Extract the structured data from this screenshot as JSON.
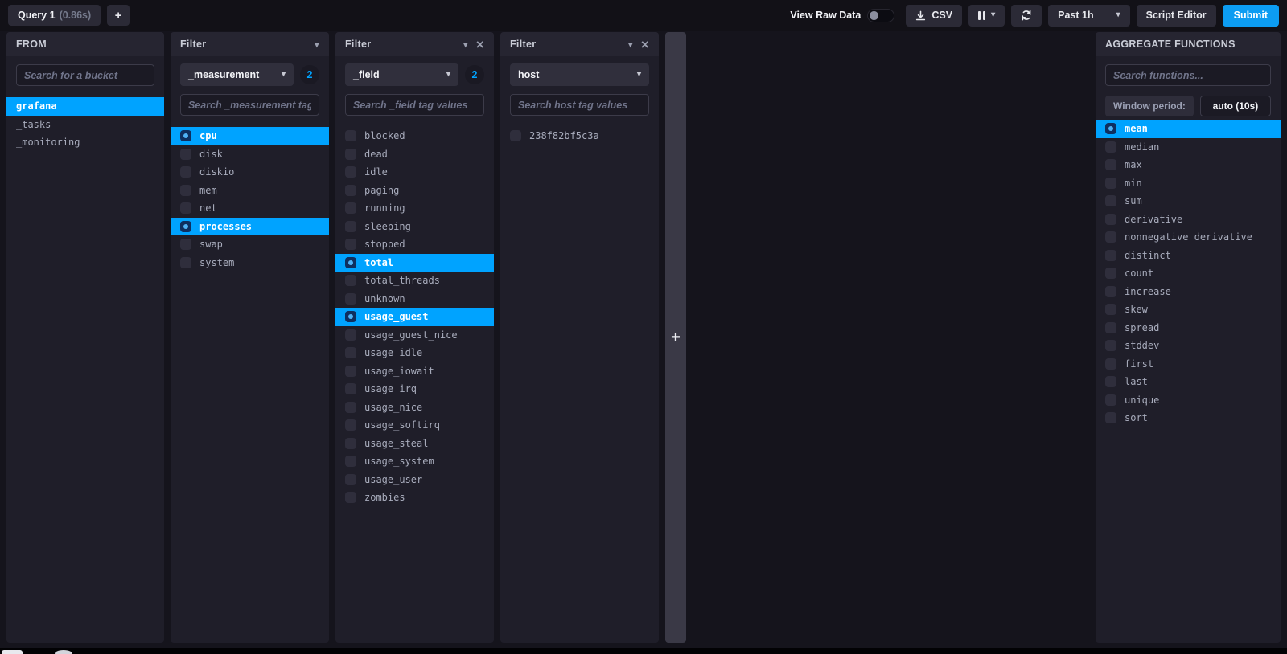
{
  "colors": {
    "accent": "#00a3ff",
    "submit": "#0c9cf2",
    "panel": "#1f1e29",
    "header": "#262531"
  },
  "topbar": {
    "query_tab": {
      "label": "Query 1",
      "duration": "(0.86s)"
    },
    "add_query_label": "+",
    "view_raw_data_label": "View Raw Data",
    "csv_label": "CSV",
    "time_range_label": "Past 1h",
    "script_editor_label": "Script Editor",
    "submit_label": "Submit"
  },
  "from_panel": {
    "title": "FROM",
    "search_placeholder": "Search for a bucket",
    "buckets": [
      {
        "label": "grafana",
        "selected": true
      },
      {
        "label": "_tasks",
        "selected": false
      },
      {
        "label": "_monitoring",
        "selected": false
      }
    ]
  },
  "filters": [
    {
      "title": "Filter",
      "key": "_measurement",
      "count": "2",
      "search_placeholder": "Search _measurement tag values",
      "items": [
        {
          "label": "cpu",
          "checked": true
        },
        {
          "label": "disk",
          "checked": false
        },
        {
          "label": "diskio",
          "checked": false
        },
        {
          "label": "mem",
          "checked": false
        },
        {
          "label": "net",
          "checked": false
        },
        {
          "label": "processes",
          "checked": true
        },
        {
          "label": "swap",
          "checked": false
        },
        {
          "label": "system",
          "checked": false
        }
      ]
    },
    {
      "title": "Filter",
      "key": "_field",
      "count": "2",
      "search_placeholder": "Search _field tag values",
      "items": [
        {
          "label": "blocked",
          "checked": false
        },
        {
          "label": "dead",
          "checked": false
        },
        {
          "label": "idle",
          "checked": false
        },
        {
          "label": "paging",
          "checked": false
        },
        {
          "label": "running",
          "checked": false
        },
        {
          "label": "sleeping",
          "checked": false
        },
        {
          "label": "stopped",
          "checked": false
        },
        {
          "label": "total",
          "checked": true
        },
        {
          "label": "total_threads",
          "checked": false
        },
        {
          "label": "unknown",
          "checked": false
        },
        {
          "label": "usage_guest",
          "checked": true
        },
        {
          "label": "usage_guest_nice",
          "checked": false
        },
        {
          "label": "usage_idle",
          "checked": false
        },
        {
          "label": "usage_iowait",
          "checked": false
        },
        {
          "label": "usage_irq",
          "checked": false
        },
        {
          "label": "usage_nice",
          "checked": false
        },
        {
          "label": "usage_softirq",
          "checked": false
        },
        {
          "label": "usage_steal",
          "checked": false
        },
        {
          "label": "usage_system",
          "checked": false
        },
        {
          "label": "usage_user",
          "checked": false
        },
        {
          "label": "zombies",
          "checked": false
        }
      ]
    },
    {
      "title": "Filter",
      "key": "host",
      "count": "",
      "search_placeholder": "Search host tag values",
      "items": [
        {
          "label": "238f82bf5c3a",
          "checked": false
        }
      ]
    }
  ],
  "aggregate": {
    "title": "AGGREGATE FUNCTIONS",
    "search_placeholder": "Search functions...",
    "window_period_label": "Window period:",
    "window_period_value": "auto (10s)",
    "functions": [
      {
        "label": "mean",
        "checked": true
      },
      {
        "label": "median",
        "checked": false
      },
      {
        "label": "max",
        "checked": false
      },
      {
        "label": "min",
        "checked": false
      },
      {
        "label": "sum",
        "checked": false
      },
      {
        "label": "derivative",
        "checked": false
      },
      {
        "label": "nonnegative derivative",
        "checked": false
      },
      {
        "label": "distinct",
        "checked": false
      },
      {
        "label": "count",
        "checked": false
      },
      {
        "label": "increase",
        "checked": false
      },
      {
        "label": "skew",
        "checked": false
      },
      {
        "label": "spread",
        "checked": false
      },
      {
        "label": "stddev",
        "checked": false
      },
      {
        "label": "first",
        "checked": false
      },
      {
        "label": "last",
        "checked": false
      },
      {
        "label": "unique",
        "checked": false
      },
      {
        "label": "sort",
        "checked": false
      }
    ]
  }
}
